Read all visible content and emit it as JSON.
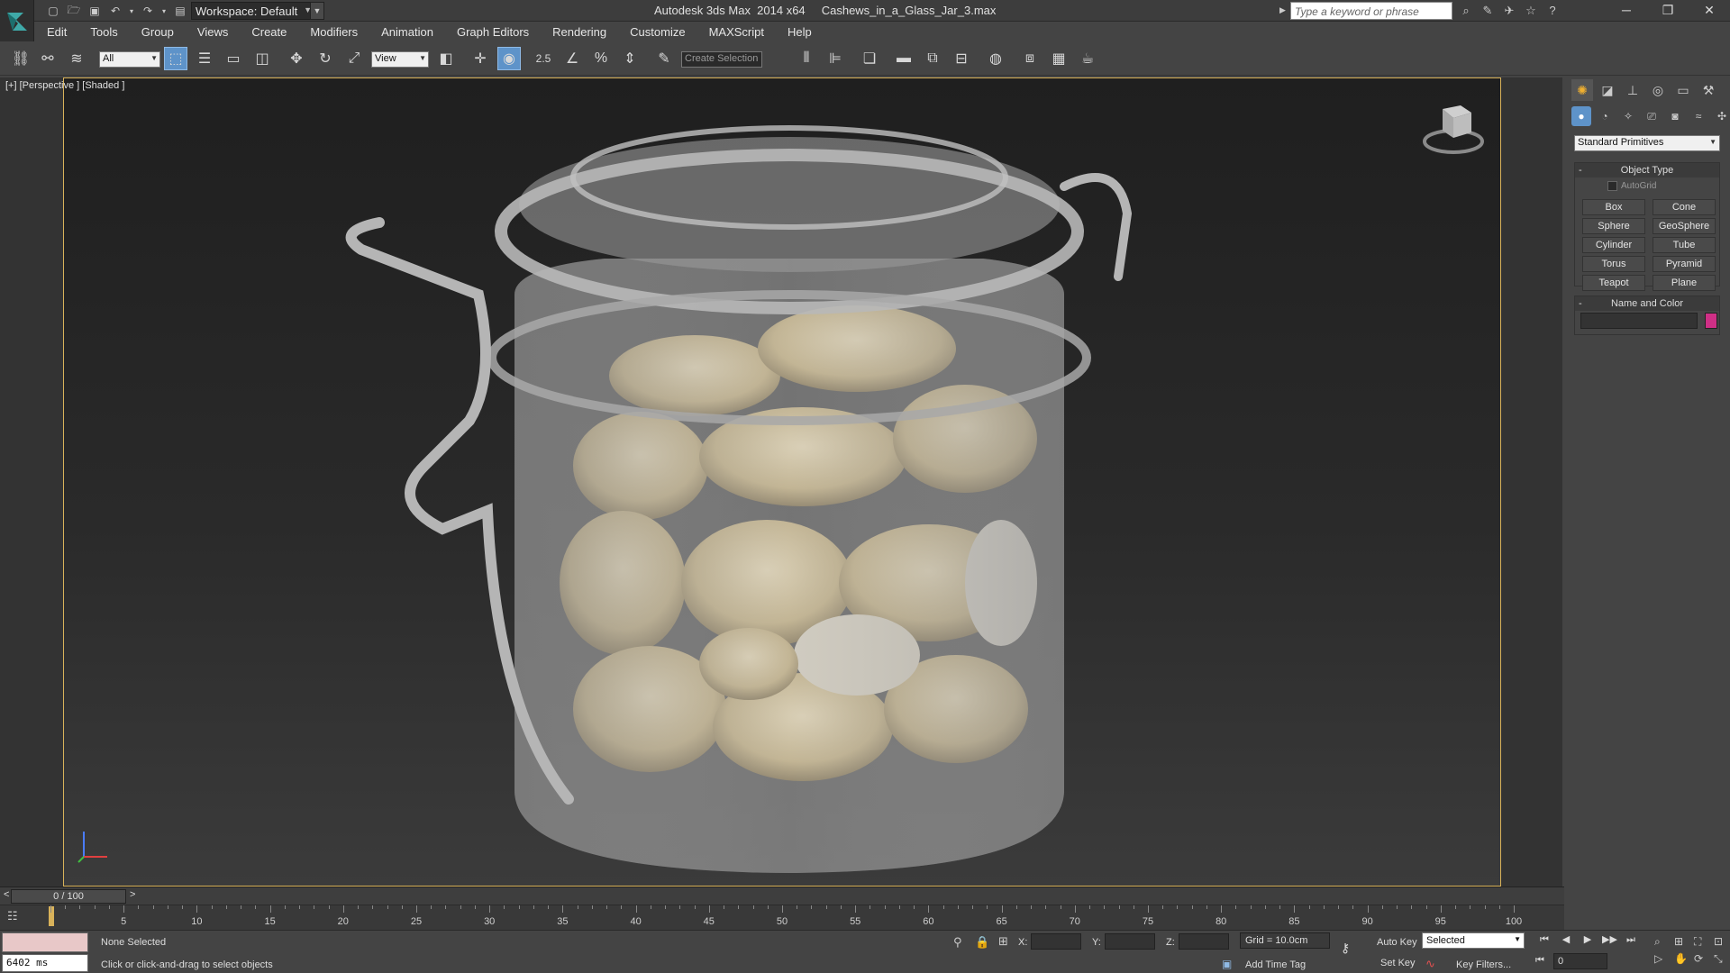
{
  "app": {
    "title": "Autodesk 3ds Max  2014 x64     Cashews_in_a_Glass_Jar_3.max",
    "workspace": "Workspace: Default",
    "search_placeholder": "Type a keyword or phrase"
  },
  "menu": [
    "Edit",
    "Tools",
    "Group",
    "Views",
    "Create",
    "Modifiers",
    "Animation",
    "Graph Editors",
    "Rendering",
    "Customize",
    "MAXScript",
    "Help"
  ],
  "toolbar": {
    "selection_filter": "All",
    "reference_coord": "View",
    "snap_label": "2.5",
    "named_selection_placeholder": "Create Selection Se"
  },
  "viewport": {
    "label": "[+] [Perspective ] [Shaded ]"
  },
  "command_panel": {
    "category": "Standard Primitives",
    "object_type_title": "Object Type",
    "autogrid": "AutoGrid",
    "object_buttons": [
      "Box",
      "Cone",
      "Sphere",
      "GeoSphere",
      "Cylinder",
      "Tube",
      "Torus",
      "Pyramid",
      "Teapot",
      "Plane"
    ],
    "name_color_title": "Name and Color",
    "object_color": "#cf2f86"
  },
  "timeline": {
    "slider": "0 / 100",
    "prev": "<",
    "next": ">",
    "ticks": [
      "5",
      "10",
      "15",
      "20",
      "25",
      "30",
      "35",
      "40",
      "45",
      "50",
      "55",
      "60",
      "65",
      "70",
      "75",
      "80",
      "85",
      "90",
      "95",
      "100"
    ]
  },
  "status": {
    "selection": "None Selected",
    "prompt": "Click or click-and-drag to select objects",
    "time_ms": "6402 ms",
    "x_label": "X:",
    "y_label": "Y:",
    "z_label": "Z:",
    "grid": "Grid = 10.0cm",
    "add_time_tag": "Add Time Tag",
    "auto_key": "Auto Key",
    "set_key": "Set Key",
    "key_mode": "Selected",
    "key_filters": "Key Filters...",
    "current_frame": "0"
  }
}
